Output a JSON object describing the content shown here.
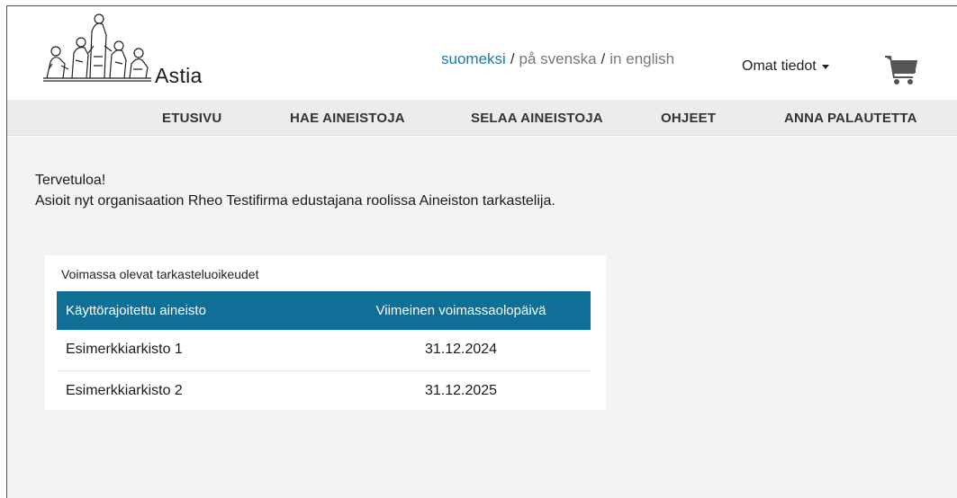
{
  "header": {
    "brand": "Astia",
    "languages": [
      {
        "label": "suomeksi",
        "active": true
      },
      {
        "label": "på svenska",
        "active": false
      },
      {
        "label": "in english",
        "active": false
      }
    ],
    "separator": "/",
    "profile_label": "Omat tiedot",
    "cart_icon": "shopping-cart-icon"
  },
  "nav": {
    "items": [
      "ETUSIVU",
      "HAE AINEISTOJA",
      "SELAA AINEISTOJA",
      "OHJEET",
      "ANNA PALAUTETTA"
    ]
  },
  "main": {
    "welcome_title": "Tervetuloa!",
    "welcome_text": "Asioit nyt organisaation Rheo Testifirma edustajana roolissa Aineiston tarkastelija.",
    "permissions": {
      "title": "Voimassa olevat tarkasteluoikeudet",
      "columns": [
        "Käyttörajoitettu aineisto",
        "Viimeinen voimassaolopäivä"
      ],
      "rows": [
        {
          "name": "Esimerkkiarkisto 1",
          "date": "31.12.2024"
        },
        {
          "name": "Esimerkkiarkisto 2",
          "date": "31.12.2025"
        }
      ]
    }
  },
  "colors": {
    "accent": "#1a7aa6",
    "table_header": "#0f6f97",
    "nav_bg": "#ececec",
    "content_bg": "#f3f3f3"
  }
}
